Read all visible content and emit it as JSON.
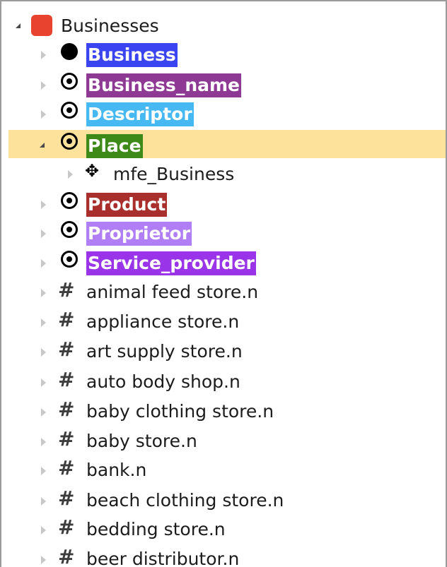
{
  "tree": {
    "root": {
      "label": "Businesses",
      "icon": "red-square-icon",
      "color": "#e8432f",
      "expanded": true
    },
    "frames": [
      {
        "label": "Business",
        "icon": "filled-circle-icon",
        "color": "#3a44f0",
        "expanded": false
      },
      {
        "label": "Business_name",
        "icon": "target-circle-icon",
        "color": "#8e3a94",
        "expanded": false
      },
      {
        "label": "Descriptor",
        "icon": "target-circle-icon",
        "color": "#46b8f2",
        "expanded": false
      },
      {
        "label": "Place",
        "icon": "target-circle-icon",
        "color": "#3d8a18",
        "expanded": true,
        "selected": true,
        "children": [
          {
            "label": "mfe_Business",
            "icon": "four-way-arrow-icon",
            "expanded": false
          }
        ]
      },
      {
        "label": "Product",
        "icon": "target-circle-icon",
        "color": "#a82f2c",
        "expanded": false
      },
      {
        "label": "Proprietor",
        "icon": "target-circle-icon",
        "color": "#b07ef5",
        "expanded": false
      },
      {
        "label": "Service_provider",
        "icon": "target-circle-icon",
        "color": "#9a34e8",
        "expanded": false
      }
    ],
    "lexical_units": [
      {
        "label": "animal feed store.n",
        "icon": "hash-icon"
      },
      {
        "label": "appliance store.n",
        "icon": "hash-icon"
      },
      {
        "label": "art supply store.n",
        "icon": "hash-icon"
      },
      {
        "label": "auto body shop.n",
        "icon": "hash-icon"
      },
      {
        "label": "baby clothing store.n",
        "icon": "hash-icon"
      },
      {
        "label": "baby store.n",
        "icon": "hash-icon"
      },
      {
        "label": "bank.n",
        "icon": "hash-icon"
      },
      {
        "label": "beach clothing store.n",
        "icon": "hash-icon"
      },
      {
        "label": "bedding store.n",
        "icon": "hash-icon"
      },
      {
        "label": "beer distributor.n",
        "icon": "hash-icon"
      }
    ],
    "selected_row_color": "#fce29a",
    "toggle_collapsed_color": "#c8c8c8",
    "toggle_expanded_color": "#4a4a4a"
  }
}
